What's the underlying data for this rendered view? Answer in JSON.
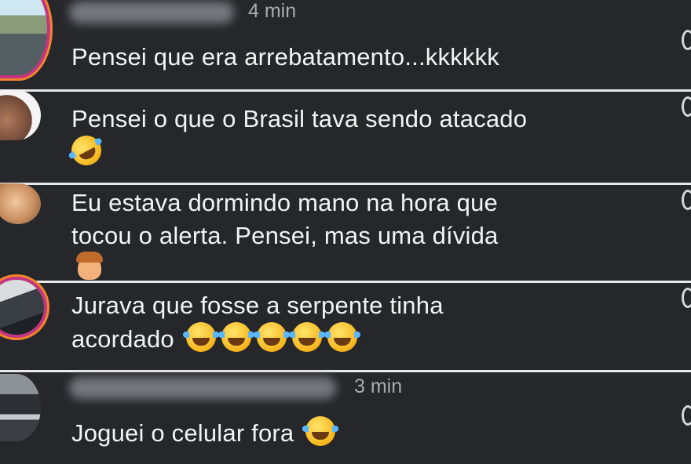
{
  "comments": [
    {
      "time": "4 min",
      "text": "Pensei que era arrebatamento...kkkkkk"
    },
    {
      "text": "Pensei o que o Brasil tava sendo atacado",
      "emoji": "rolling-on-floor-laughing"
    },
    {
      "line1": "Eu estava dormindo mano na hora que",
      "line2": "tocou o alerta. Pensei, mas uma dívida",
      "emoji": "facepalm"
    },
    {
      "line1": "Jurava que fosse a serpente tinha",
      "line2": "acordado",
      "emoji": "face-with-tears-of-joy",
      "emoji_count": 5
    },
    {
      "time": "3 min",
      "text": "Joguei o celular fora",
      "emoji": "face-with-tears-of-joy"
    }
  ],
  "colors": {
    "background": "#25272b",
    "divider": "#e9e9e9",
    "meta_text": "#a9abae",
    "story_ring": "#c13584"
  }
}
